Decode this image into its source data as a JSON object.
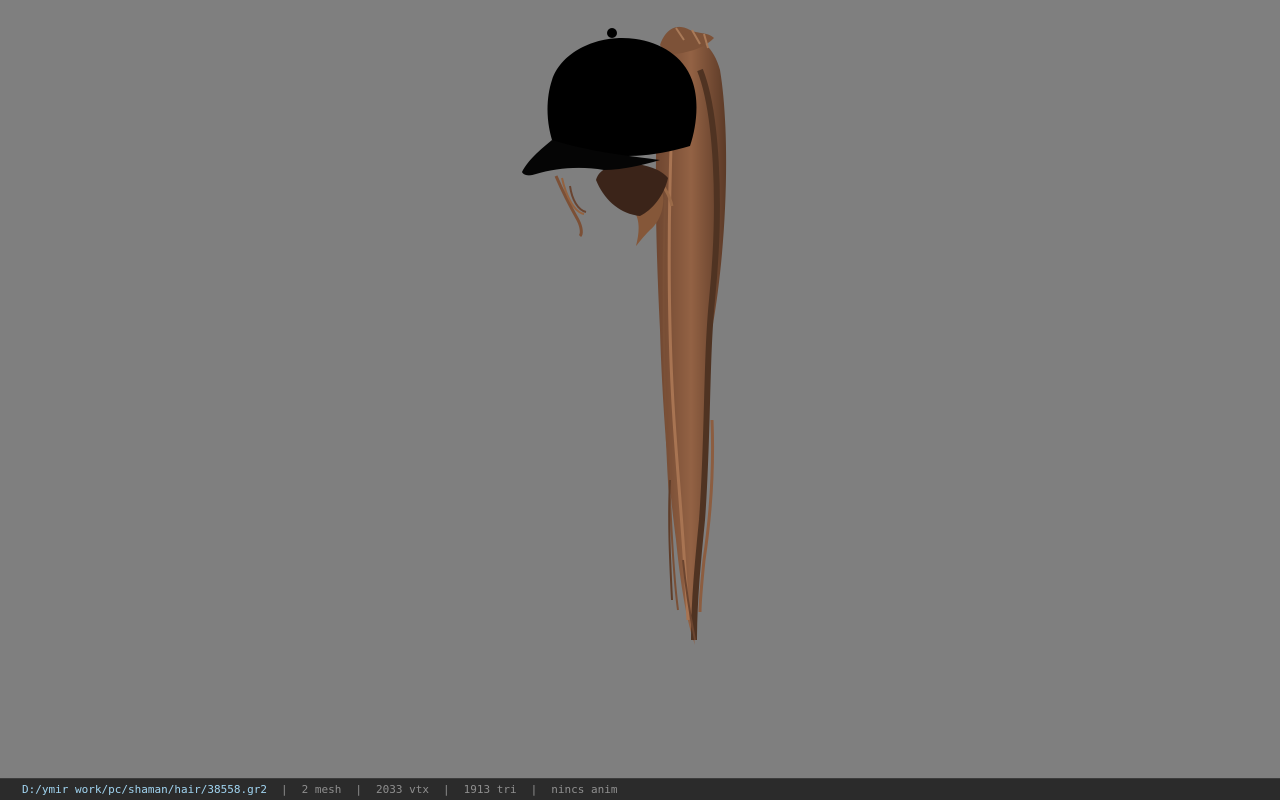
{
  "viewport": {
    "background_color": "#7f7f7f",
    "model": {
      "subject": "hair-with-cap-model",
      "cap_color": "#000000",
      "hair_color": "#8a5a3c"
    }
  },
  "statusbar": {
    "file_path": "D:/ymir work/pc/shaman/hair/38558.gr2",
    "separator": "|",
    "mesh_count": "2 mesh",
    "vertex_count": "2033 vtx",
    "triangle_count": "1913 tri",
    "anim_status": "nincs anim",
    "path_color": "#9fd2ee",
    "text_color": "#8e8e8e"
  }
}
